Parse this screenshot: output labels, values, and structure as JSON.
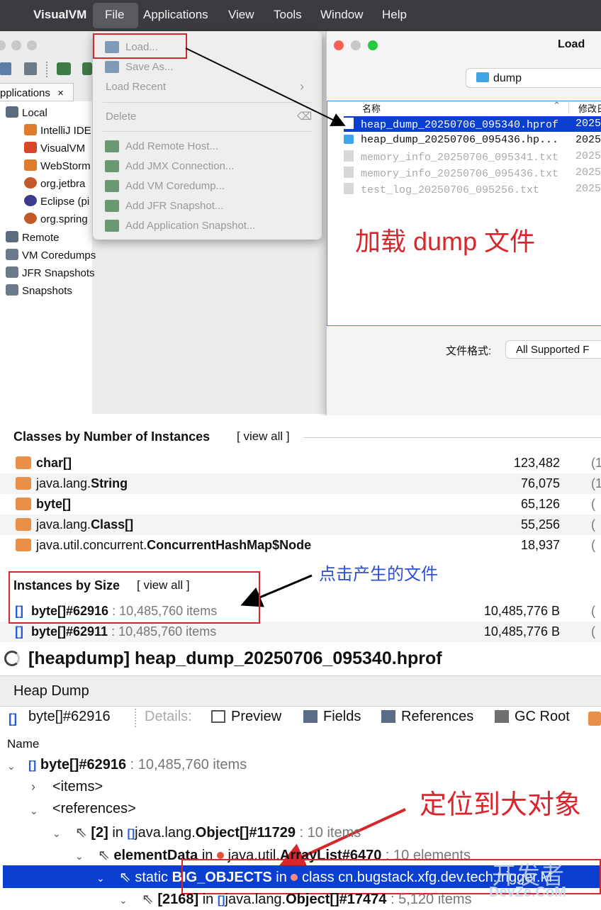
{
  "menubar": {
    "app": "VisualVM",
    "items": [
      "File",
      "Applications",
      "View",
      "Tools",
      "Window",
      "Help"
    ]
  },
  "file_menu": {
    "items": [
      {
        "label": "Load...",
        "icon": "load-icon"
      },
      {
        "label": "Save As...",
        "icon": "save-icon"
      },
      {
        "label": "Load Recent",
        "icon": "",
        "submenu": "›"
      },
      {
        "label": "Delete",
        "icon": "",
        "shortcut": "⌫"
      },
      {
        "label": "Add Remote Host...",
        "icon": "remote-host-icon"
      },
      {
        "label": "Add JMX Connection...",
        "icon": "jmx-icon"
      },
      {
        "label": "Add VM Coredump...",
        "icon": "coredump-icon"
      },
      {
        "label": "Add JFR Snapshot...",
        "icon": "jfr-icon"
      },
      {
        "label": "Add Application Snapshot...",
        "icon": "snapshot-icon"
      }
    ]
  },
  "sidebar": {
    "tab": "pplications",
    "tab_close": "×",
    "local": "Local",
    "apps": [
      "IntelliJ IDE",
      "VisualVM",
      "WebStorm",
      "org.jetbra",
      "Eclipse (pi",
      "org.spring"
    ],
    "nodes": [
      "Remote",
      "VM Coredumps",
      "JFR Snapshots",
      "Snapshots"
    ]
  },
  "dialog": {
    "title": "Load",
    "folder": "dump",
    "col_name": "名称",
    "col_modified": "修改日",
    "files": [
      {
        "name": "heap_dump_20250706_095340.hprof",
        "date": "2025",
        "selected": true,
        "type": "file"
      },
      {
        "name": "heap_dump_20250706_095436.hp...",
        "date": "2025",
        "selected": false,
        "type": "folder"
      },
      {
        "name": "memory_info_20250706_095341.txt",
        "date": "2025",
        "selected": false,
        "type": "dim"
      },
      {
        "name": "memory_info_20250706_095436.txt",
        "date": "2025",
        "selected": false,
        "type": "dim"
      },
      {
        "name": "test_log_20250706_095256.txt",
        "date": "2025",
        "selected": false,
        "type": "dim"
      }
    ],
    "format_label": "文件格式:",
    "format_value": "All Supported F"
  },
  "annotations": {
    "load_dump": "加载 dump 文件",
    "click_file": "点击产生的文件",
    "locate_big": "定位到大对象"
  },
  "classes_section": {
    "title": "Classes by Number of Instances",
    "view_all": "[ view all ]",
    "rows": [
      {
        "pkg": "",
        "cls": "char[]",
        "count": "123,482",
        "par": "(1"
      },
      {
        "pkg": "java.lang.",
        "cls": "String",
        "count": "76,075",
        "par": "(1"
      },
      {
        "pkg": "",
        "cls": "byte[]",
        "count": "65,126",
        "par": "("
      },
      {
        "pkg": "java.lang.",
        "cls": "Class[]",
        "count": "55,256",
        "par": "("
      },
      {
        "pkg": "java.util.concurrent.",
        "cls": "ConcurrentHashMap$Node",
        "count": "18,937",
        "par": "("
      }
    ]
  },
  "instances_section": {
    "title": "Instances by Size",
    "view_all": "[ view all ]",
    "rows": [
      {
        "name": "byte[]#62916",
        "items": ": 10,485,760 items",
        "size": "10,485,776 B",
        "par": "("
      },
      {
        "name": "byte[]#62911",
        "items": ": 10,485,760 items",
        "size": "10,485,776 B",
        "par": "("
      }
    ]
  },
  "heapdump": {
    "title": "[heapdump] heap_dump_20250706_095340.hprof",
    "tab": "Heap Dump",
    "object": "byte[]#62916",
    "details": "Details:",
    "buttons": [
      "Preview",
      "Fields",
      "References",
      "GC Root"
    ],
    "column": "Name"
  },
  "tree": {
    "root_name": "byte[]#62916",
    "root_items": ": 10,485,760 items",
    "items_node": "<items>",
    "references_node": "<references>",
    "ref1_index": "[2]",
    "ref1_in": "in",
    "ref1_pkg": "java.lang.",
    "ref1_cls": "Object[]#11729",
    "ref1_extra": ": 10 items",
    "ref2_field": "elementData",
    "ref2_in": "in",
    "ref2_pkg": "java.util.",
    "ref2_cls": "ArrayList#6470",
    "ref2_extra": ": 10 elements",
    "ref3_static": "static",
    "ref3_field": "BIG_OBJECTS",
    "ref3_in": "in",
    "ref3_class": "class cn.bugstack.xfg.dev.tech.trigger.M",
    "ref4_index": "[2168]",
    "ref4_in": "in",
    "ref4_pkg": "java.lang.",
    "ref4_cls": "Object[]#17474",
    "ref4_extra": ": 5,120 items"
  },
  "watermark": {
    "top": "开发者",
    "bottom": "DevZe.CoM"
  },
  "colors": {
    "accent": "#1a5fd6",
    "selection": "#0b3fcf",
    "annotation": "#d8262c",
    "note_blue": "#2b50d6"
  }
}
